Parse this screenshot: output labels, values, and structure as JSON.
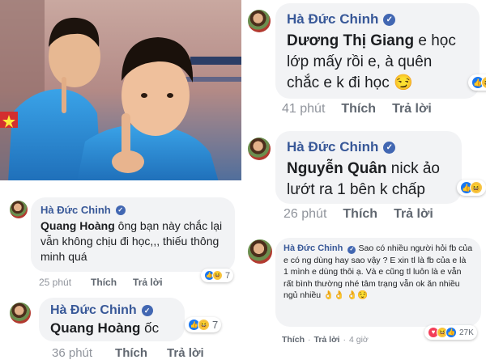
{
  "comments": [
    {
      "name": "Hà Đức Chinh",
      "mention": "Dương Thị Giang",
      "text": " e học lớp mấy rồi e, à quên chắc e k đi học 😏",
      "time": "41 phút",
      "like": "Thích",
      "reply": "Trả lời",
      "reactions": "like-haha"
    },
    {
      "name": "Hà Đức Chinh",
      "mention": "Nguyễn Quân",
      "text": " nick ảo lướt ra 1 bên k chấp",
      "time": "26 phút",
      "like": "Thích",
      "reply": "Trả lời",
      "reactions": "like-haha"
    },
    {
      "name": "Hà Đức Chinh",
      "mention": "Quang Hoàng",
      "text": " ông bạn này chắc lại vẫn không chịu đi học,,, thiếu thông minh quá",
      "time": "25 phút",
      "like": "Thích",
      "reply": "Trả lời",
      "reaction_count": "7"
    },
    {
      "name": "Hà Đức Chinh",
      "mention": "Quang Hoàng",
      "text": " ốc",
      "time": "36 phút",
      "like": "Thích",
      "reply": "Trả lời",
      "reaction_count": "7"
    },
    {
      "name": "Hà Đức Chinh",
      "text": "Sao có nhiều người hỏi fb của e có ng dùng hay sao vậy ? E xin tl là fb của e là 1 mình e dùng thôi ạ. Và e cũng tl luôn là e vẫn rất bình thường nhé tâm trạng vẫn ok ăn nhiều ngủ nhiều 👌👌 👌😌",
      "like": "Thích",
      "reply": "Trả lời",
      "time": "4 giờ",
      "reaction_count": "27K"
    }
  ],
  "colors": {
    "name": "#385898",
    "bubble": "#f2f3f5",
    "verified": "#4267b2",
    "meta": "#90949c"
  },
  "icons": [
    "verified-badge-icon",
    "like-reaction-icon",
    "haha-reaction-icon",
    "love-reaction-icon"
  ]
}
